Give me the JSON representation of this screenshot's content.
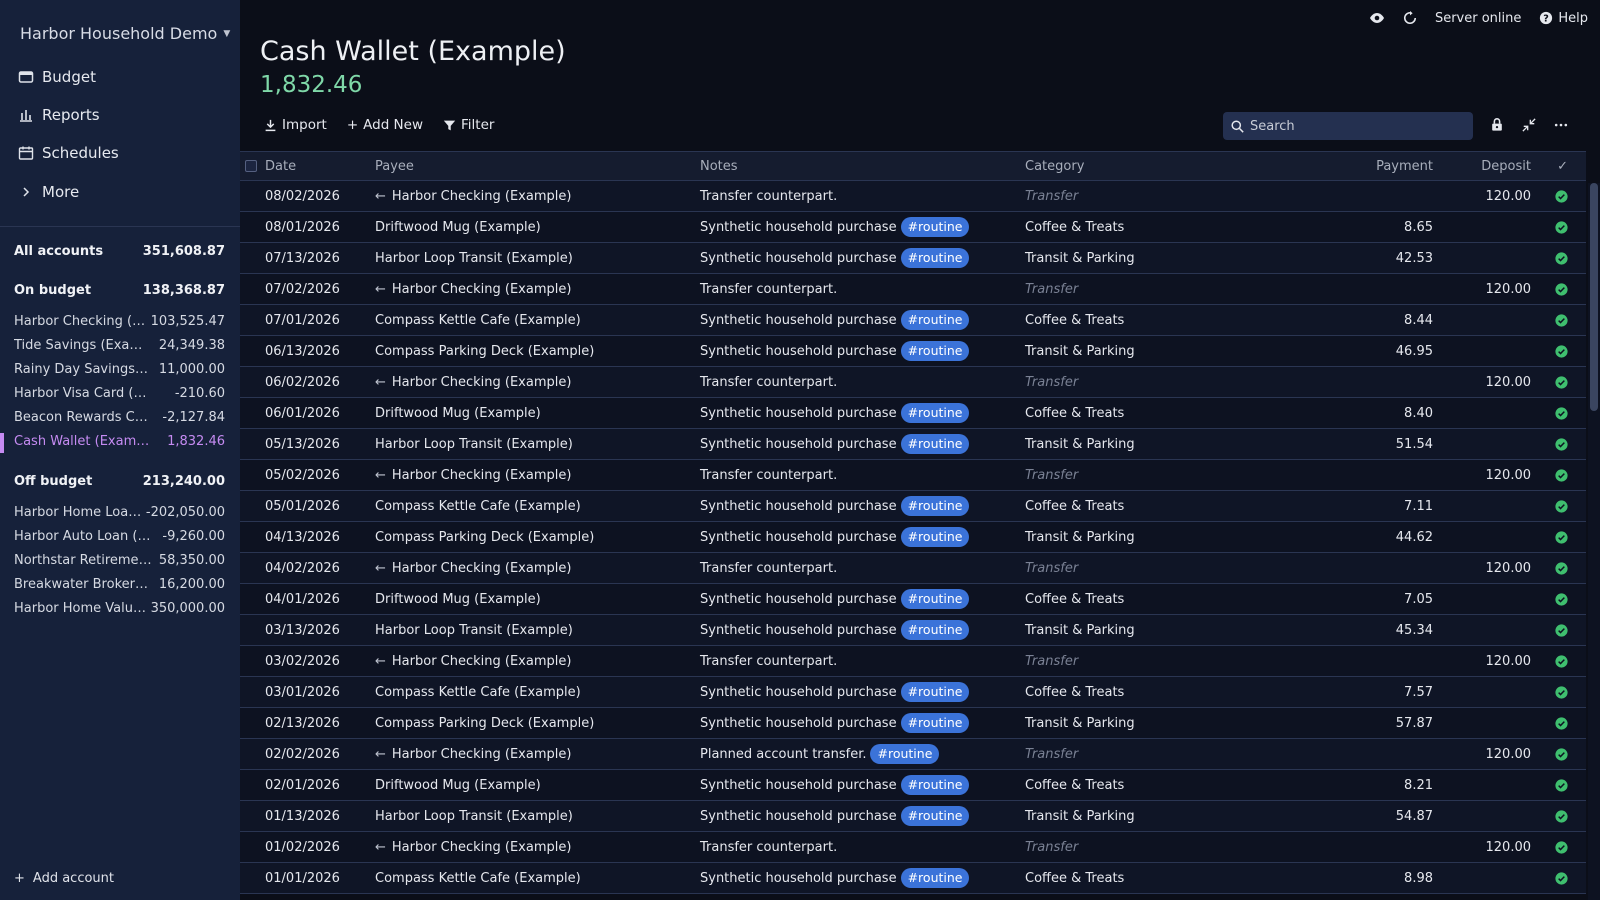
{
  "sidebar": {
    "budget_name": "Harbor Household Demo",
    "nav": [
      {
        "label": "Budget",
        "icon": "wallet-icon"
      },
      {
        "label": "Reports",
        "icon": "bar-chart-icon"
      },
      {
        "label": "Schedules",
        "icon": "calendar-icon"
      },
      {
        "label": "More",
        "icon": "chevron-right-icon"
      }
    ],
    "all_accounts": {
      "label": "All accounts",
      "value": "351,608.87"
    },
    "on_budget": {
      "label": "On budget",
      "value": "138,368.87"
    },
    "on_budget_accounts": [
      {
        "name": "Harbor Checking (Example)",
        "value": "103,525.47"
      },
      {
        "name": "Tide Savings (Example)",
        "value": "24,349.38"
      },
      {
        "name": "Rainy Day Savings (Example)",
        "value": "11,000.00"
      },
      {
        "name": "Harbor Visa Card (Example)",
        "value": "-210.60"
      },
      {
        "name": "Beacon Rewards Card (Example)",
        "value": "-2,127.84"
      },
      {
        "name": "Cash Wallet (Example)",
        "value": "1,832.46"
      }
    ],
    "off_budget": {
      "label": "Off budget",
      "value": "213,240.00"
    },
    "off_budget_accounts": [
      {
        "name": "Harbor Home Loan (Example)",
        "value": "-202,050.00"
      },
      {
        "name": "Harbor Auto Loan (Example)",
        "value": "-9,260.00"
      },
      {
        "name": "Northstar Retirement (Example)",
        "value": "58,350.00"
      },
      {
        "name": "Breakwater Brokerage (Example)",
        "value": "16,200.00"
      },
      {
        "name": "Harbor Home Value (Example)",
        "value": "350,000.00"
      }
    ],
    "add_account": "Add account"
  },
  "topbar": {
    "server_status": "Server online",
    "help": "Help"
  },
  "account": {
    "title": "Cash Wallet (Example)",
    "balance": "1,832.46"
  },
  "toolbar": {
    "import": "Import",
    "add_new": "Add New",
    "filter": "Filter",
    "search_placeholder": "Search"
  },
  "table": {
    "headers": {
      "date": "Date",
      "payee": "Payee",
      "notes": "Notes",
      "category": "Category",
      "payment": "Payment",
      "deposit": "Deposit",
      "cleared": "✓"
    },
    "rows": [
      {
        "date": "08/02/2026",
        "payee": "Harbor Checking (Example)",
        "transfer": true,
        "notes": "Transfer counterpart.",
        "tag": "",
        "category": "Transfer",
        "payment": "",
        "deposit": "120.00"
      },
      {
        "date": "08/01/2026",
        "payee": "Driftwood Mug (Example)",
        "transfer": false,
        "notes": "Synthetic household purchase",
        "tag": "#routine",
        "category": "Coffee & Treats",
        "payment": "8.65",
        "deposit": ""
      },
      {
        "date": "07/13/2026",
        "payee": "Harbor Loop Transit (Example)",
        "transfer": false,
        "notes": "Synthetic household purchase",
        "tag": "#routine",
        "category": "Transit & Parking",
        "payment": "42.53",
        "deposit": ""
      },
      {
        "date": "07/02/2026",
        "payee": "Harbor Checking (Example)",
        "transfer": true,
        "notes": "Transfer counterpart.",
        "tag": "",
        "category": "Transfer",
        "payment": "",
        "deposit": "120.00"
      },
      {
        "date": "07/01/2026",
        "payee": "Compass Kettle Cafe (Example)",
        "transfer": false,
        "notes": "Synthetic household purchase",
        "tag": "#routine",
        "category": "Coffee & Treats",
        "payment": "8.44",
        "deposit": ""
      },
      {
        "date": "06/13/2026",
        "payee": "Compass Parking Deck (Example)",
        "transfer": false,
        "notes": "Synthetic household purchase",
        "tag": "#routine",
        "category": "Transit & Parking",
        "payment": "46.95",
        "deposit": ""
      },
      {
        "date": "06/02/2026",
        "payee": "Harbor Checking (Example)",
        "transfer": true,
        "notes": "Transfer counterpart.",
        "tag": "",
        "category": "Transfer",
        "payment": "",
        "deposit": "120.00"
      },
      {
        "date": "06/01/2026",
        "payee": "Driftwood Mug (Example)",
        "transfer": false,
        "notes": "Synthetic household purchase",
        "tag": "#routine",
        "category": "Coffee & Treats",
        "payment": "8.40",
        "deposit": ""
      },
      {
        "date": "05/13/2026",
        "payee": "Harbor Loop Transit (Example)",
        "transfer": false,
        "notes": "Synthetic household purchase",
        "tag": "#routine",
        "category": "Transit & Parking",
        "payment": "51.54",
        "deposit": ""
      },
      {
        "date": "05/02/2026",
        "payee": "Harbor Checking (Example)",
        "transfer": true,
        "notes": "Transfer counterpart.",
        "tag": "",
        "category": "Transfer",
        "payment": "",
        "deposit": "120.00"
      },
      {
        "date": "05/01/2026",
        "payee": "Compass Kettle Cafe (Example)",
        "transfer": false,
        "notes": "Synthetic household purchase",
        "tag": "#routine",
        "category": "Coffee & Treats",
        "payment": "7.11",
        "deposit": ""
      },
      {
        "date": "04/13/2026",
        "payee": "Compass Parking Deck (Example)",
        "transfer": false,
        "notes": "Synthetic household purchase",
        "tag": "#routine",
        "category": "Transit & Parking",
        "payment": "44.62",
        "deposit": ""
      },
      {
        "date": "04/02/2026",
        "payee": "Harbor Checking (Example)",
        "transfer": true,
        "notes": "Transfer counterpart.",
        "tag": "",
        "category": "Transfer",
        "payment": "",
        "deposit": "120.00"
      },
      {
        "date": "04/01/2026",
        "payee": "Driftwood Mug (Example)",
        "transfer": false,
        "notes": "Synthetic household purchase",
        "tag": "#routine",
        "category": "Coffee & Treats",
        "payment": "7.05",
        "deposit": ""
      },
      {
        "date": "03/13/2026",
        "payee": "Harbor Loop Transit (Example)",
        "transfer": false,
        "notes": "Synthetic household purchase",
        "tag": "#routine",
        "category": "Transit & Parking",
        "payment": "45.34",
        "deposit": ""
      },
      {
        "date": "03/02/2026",
        "payee": "Harbor Checking (Example)",
        "transfer": true,
        "notes": "Transfer counterpart.",
        "tag": "",
        "category": "Transfer",
        "payment": "",
        "deposit": "120.00"
      },
      {
        "date": "03/01/2026",
        "payee": "Compass Kettle Cafe (Example)",
        "transfer": false,
        "notes": "Synthetic household purchase",
        "tag": "#routine",
        "category": "Coffee & Treats",
        "payment": "7.57",
        "deposit": ""
      },
      {
        "date": "02/13/2026",
        "payee": "Compass Parking Deck (Example)",
        "transfer": false,
        "notes": "Synthetic household purchase",
        "tag": "#routine",
        "category": "Transit & Parking",
        "payment": "57.87",
        "deposit": ""
      },
      {
        "date": "02/02/2026",
        "payee": "Harbor Checking (Example)",
        "transfer": true,
        "notes": "Planned account transfer.",
        "tag": "#routine",
        "category": "Transfer",
        "payment": "",
        "deposit": "120.00"
      },
      {
        "date": "02/01/2026",
        "payee": "Driftwood Mug (Example)",
        "transfer": false,
        "notes": "Synthetic household purchase",
        "tag": "#routine",
        "category": "Coffee & Treats",
        "payment": "8.21",
        "deposit": ""
      },
      {
        "date": "01/13/2026",
        "payee": "Harbor Loop Transit (Example)",
        "transfer": false,
        "notes": "Synthetic household purchase",
        "tag": "#routine",
        "category": "Transit & Parking",
        "payment": "54.87",
        "deposit": ""
      },
      {
        "date": "01/02/2026",
        "payee": "Harbor Checking (Example)",
        "transfer": true,
        "notes": "Transfer counterpart.",
        "tag": "",
        "category": "Transfer",
        "payment": "",
        "deposit": "120.00"
      },
      {
        "date": "01/01/2026",
        "payee": "Compass Kettle Cafe (Example)",
        "transfer": false,
        "notes": "Synthetic household purchase",
        "tag": "#routine",
        "category": "Coffee & Treats",
        "payment": "8.98",
        "deposit": ""
      }
    ]
  },
  "colors": {
    "accent_purple": "#c58bf2",
    "balance_green": "#7fd8a8",
    "tag_blue": "#3b73d9",
    "cleared_green": "#3fbf6f"
  }
}
